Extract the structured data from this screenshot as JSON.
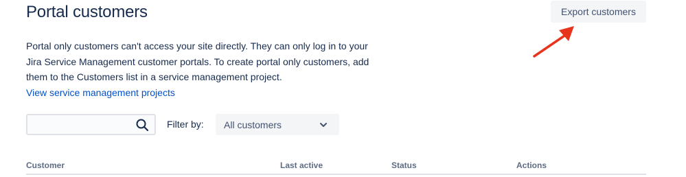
{
  "header": {
    "title": "Portal customers",
    "export_label": "Export customers"
  },
  "description": {
    "text": "Portal only customers can't access your site directly. They can only log in to your Jira Service Management customer portals. To create portal only customers, add them to the Customers list in a service management project.",
    "link_label": "View service management projects"
  },
  "toolbar": {
    "search_value": "",
    "search_icon": "search-icon",
    "filter_label": "Filter by:",
    "filter_value": "All customers",
    "filter_icon": "chevron-down-icon"
  },
  "table": {
    "columns": [
      "Customer",
      "Last active",
      "Status",
      "Actions"
    ]
  },
  "annotation": {
    "icon": "arrow-annotation",
    "color": "#E8341C"
  },
  "colors": {
    "text": "#172B4D",
    "link": "#0052CC",
    "button_bg": "#F4F5F7",
    "header_text": "#5E6C84"
  }
}
